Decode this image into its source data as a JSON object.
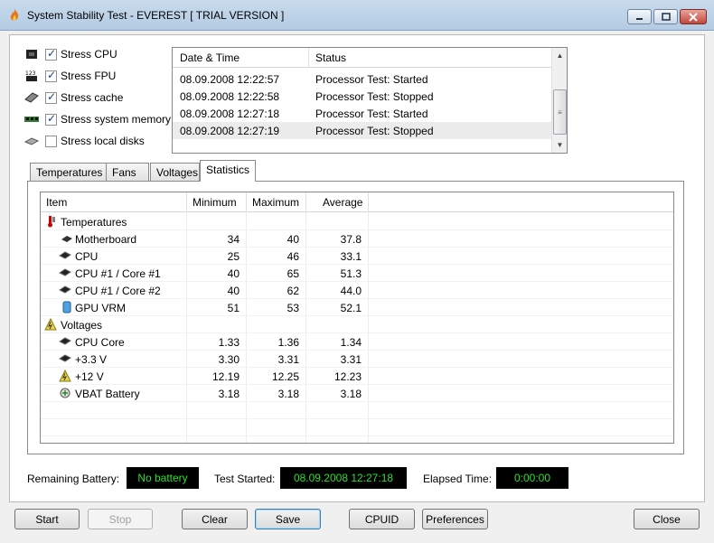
{
  "window": {
    "title": "System Stability Test - EVEREST  [ TRIAL VERSION ]",
    "icon": "flame-icon"
  },
  "stress_options": [
    {
      "label": "Stress CPU",
      "checked": true,
      "icon": "cpu-chip-icon"
    },
    {
      "label": "Stress FPU",
      "checked": true,
      "icon": "fpu-icon"
    },
    {
      "label": "Stress cache",
      "checked": true,
      "icon": "cache-icon"
    },
    {
      "label": "Stress system memory",
      "checked": true,
      "icon": "memory-module-icon"
    },
    {
      "label": "Stress local disks",
      "checked": false,
      "icon": "hard-disk-icon"
    }
  ],
  "log": {
    "columns": [
      "Date & Time",
      "Status"
    ],
    "rows": [
      {
        "datetime": "08.09.2008 12:22:57",
        "status": "Processor Test: Started"
      },
      {
        "datetime": "08.09.2008 12:22:58",
        "status": "Processor Test: Stopped"
      },
      {
        "datetime": "08.09.2008 12:27:18",
        "status": "Processor Test: Started"
      },
      {
        "datetime": "08.09.2008 12:27:19",
        "status": "Processor Test: Stopped"
      }
    ]
  },
  "tabs": [
    {
      "label": "Temperatures",
      "active": false
    },
    {
      "label": "Fans",
      "active": false
    },
    {
      "label": "Voltages",
      "active": false
    },
    {
      "label": "Statistics",
      "active": true
    }
  ],
  "statistics": {
    "columns": [
      "Item",
      "Minimum",
      "Maximum",
      "Average"
    ],
    "groups": [
      {
        "label": "Temperatures",
        "icon": "thermometer-icon",
        "items": [
          {
            "label": "Motherboard",
            "min": "34",
            "max": "40",
            "avg": "37.8",
            "icon": "motherboard-icon"
          },
          {
            "label": "CPU",
            "min": "25",
            "max": "46",
            "avg": "33.1",
            "icon": "cpu-icon"
          },
          {
            "label": "CPU #1 / Core #1",
            "min": "40",
            "max": "65",
            "avg": "51.3",
            "icon": "cpu-icon"
          },
          {
            "label": "CPU #1 / Core #2",
            "min": "40",
            "max": "62",
            "avg": "44.0",
            "icon": "cpu-icon"
          },
          {
            "label": "GPU VRM",
            "min": "51",
            "max": "53",
            "avg": "52.1",
            "icon": "gpu-icon"
          }
        ]
      },
      {
        "label": "Voltages",
        "icon": "voltage-warning-icon",
        "items": [
          {
            "label": "CPU Core",
            "min": "1.33",
            "max": "1.36",
            "avg": "1.34",
            "icon": "cpu-icon"
          },
          {
            "label": "+3.3 V",
            "min": "3.30",
            "max": "3.31",
            "avg": "3.31",
            "icon": "cpu-icon"
          },
          {
            "label": "+12 V",
            "min": "12.19",
            "max": "12.25",
            "avg": "12.23",
            "icon": "voltage-warning-icon"
          },
          {
            "label": "VBAT Battery",
            "min": "3.18",
            "max": "3.18",
            "avg": "3.18",
            "icon": "battery-icon"
          }
        ]
      }
    ]
  },
  "status": {
    "battery_label": "Remaining Battery:",
    "battery_value": "No battery",
    "started_label": "Test Started:",
    "started_value": "08.09.2008 12:27:18",
    "elapsed_label": "Elapsed Time:",
    "elapsed_value": "0:00:00"
  },
  "buttons": {
    "start": "Start",
    "stop": "Stop",
    "clear": "Clear",
    "save": "Save",
    "cpuid": "CPUID",
    "preferences": "Preferences",
    "close": "Close"
  },
  "colors": {
    "lcd_bg": "#000000",
    "lcd_text": "#27e227",
    "titlebar": "#b9cfe5"
  }
}
